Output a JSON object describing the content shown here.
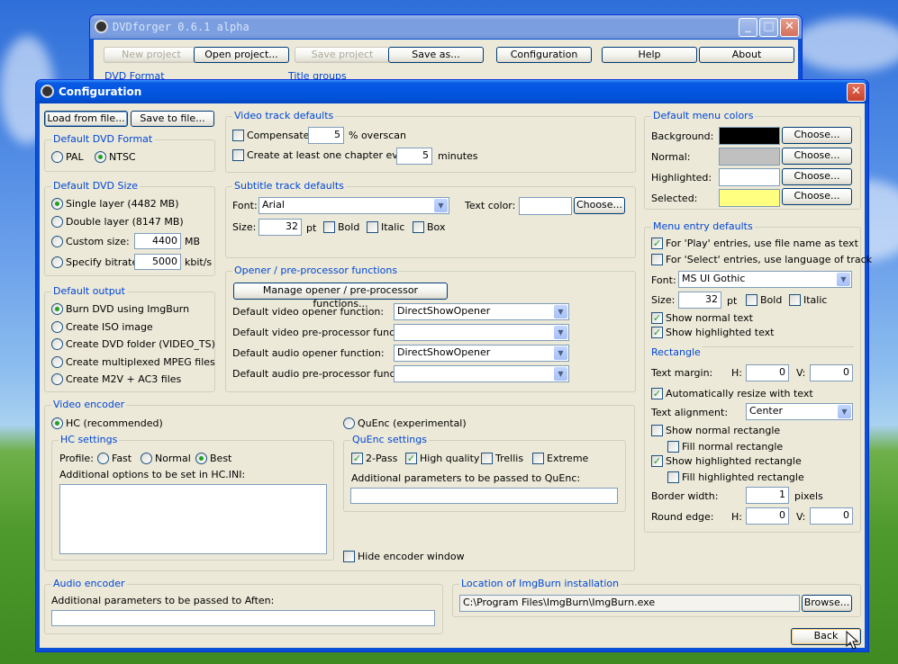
{
  "colors": {
    "bg_black": "#000000",
    "normal": "#c0c0c0",
    "highlighted": "#ffffff",
    "selected": "#ffff80"
  },
  "main_window": {
    "title": "DVDforger 0.6.1 alpha",
    "toolbar": [
      "New project",
      "Open project...",
      "Save project",
      "Save as...",
      "Configuration",
      "Help",
      "About"
    ],
    "tabs": [
      "DVD Format",
      "Title groups"
    ]
  },
  "config": {
    "title": "Configuration",
    "load_btn": "Load from file...",
    "save_btn": "Save to file...",
    "dvd_format": {
      "title": "Default DVD Format",
      "pal": "PAL",
      "ntsc": "NTSC"
    },
    "dvd_size": {
      "title": "Default DVD Size",
      "single": "Single layer (4482 MB)",
      "double": "Double layer (8147 MB)",
      "custom": "Custom size:",
      "custom_val": "4400",
      "custom_unit": "MB",
      "bitrate": "Specify bitrate:",
      "bitrate_val": "5000",
      "bitrate_unit": "kbit/s"
    },
    "output": {
      "title": "Default output",
      "opts": [
        "Burn DVD using ImgBurn",
        "Create ISO image",
        "Create DVD folder (VIDEO_TS)",
        "Create multiplexed MPEG files",
        "Create M2V + AC3 files"
      ]
    },
    "video_track": {
      "title": "Video track defaults",
      "compensate": "Compensate",
      "overscan_val": "5",
      "overscan_lbl": "% overscan",
      "chapter": "Create at least one chapter every",
      "chapter_val": "5",
      "chapter_unit": "minutes"
    },
    "subtitle": {
      "title": "Subtitle track defaults",
      "font_lbl": "Font:",
      "font": "Arial",
      "textcolor_lbl": "Text color:",
      "choose": "Choose...",
      "size_lbl": "Size:",
      "size": "32",
      "pt": "pt",
      "bold": "Bold",
      "italic": "Italic",
      "box": "Box"
    },
    "opener": {
      "title": "Opener / pre-processor functions",
      "manage": "Manage opener / pre-processor functions...",
      "rows": [
        {
          "label": "Default video opener function:",
          "value": "DirectShowOpener"
        },
        {
          "label": "Default video pre-processor function:",
          "value": ""
        },
        {
          "label": "Default audio opener function:",
          "value": "DirectShowOpener"
        },
        {
          "label": "Default audio pre-processor function:",
          "value": ""
        }
      ]
    },
    "menu_colors": {
      "title": "Default menu colors",
      "background": "Background:",
      "normal": "Normal:",
      "highlighted": "Highlighted:",
      "selected": "Selected:",
      "choose": "Choose..."
    },
    "menu_entry": {
      "title": "Menu entry defaults",
      "play": "For 'Play' entries, use file name as text",
      "select": "For 'Select' entries, use language of track",
      "font_lbl": "Font:",
      "font": "MS UI Gothic",
      "size_lbl": "Size:",
      "size": "32",
      "pt": "pt",
      "bold": "Bold",
      "italic": "Italic",
      "show_normal": "Show normal text",
      "show_highlighted": "Show highlighted text"
    },
    "rectangle": {
      "title": "Rectangle",
      "margin": "Text margin:",
      "h": "H:",
      "v": "V:",
      "margin_h": "0",
      "margin_v": "0",
      "auto": "Automatically resize with text",
      "align_lbl": "Text alignment:",
      "align": "Center",
      "show_normal": "Show normal rectangle",
      "fill_normal": "Fill normal rectangle",
      "show_hl": "Show highlighted rectangle",
      "fill_hl": "Fill highlighted rectangle",
      "border_lbl": "Border width:",
      "border": "1",
      "pixels": "pixels",
      "round": "Round edge:",
      "round_h": "0",
      "round_v": "0"
    },
    "video_encoder": {
      "title": "Video encoder",
      "hc": "HC (recommended)",
      "quenc": "QuEnc (experimental)",
      "hc_settings": "HC settings",
      "profile": "Profile:",
      "fast": "Fast",
      "normal": "Normal",
      "best": "Best",
      "hc_ini": "Additional options to be set in HC.INI:",
      "quenc_settings": "QuEnc settings",
      "twopass": "2-Pass",
      "hq": "High quality",
      "trellis": "Trellis",
      "extreme": "Extreme",
      "quenc_params": "Additional parameters to be passed to QuEnc:",
      "hide": "Hide encoder window"
    },
    "audio": {
      "title": "Audio encoder",
      "params": "Additional parameters to be passed to Aften:"
    },
    "imgburn": {
      "title": "Location of ImgBurn installation",
      "path": "C:\\Program Files\\ImgBurn\\ImgBurn.exe",
      "browse": "Browse..."
    },
    "back": "Back"
  }
}
